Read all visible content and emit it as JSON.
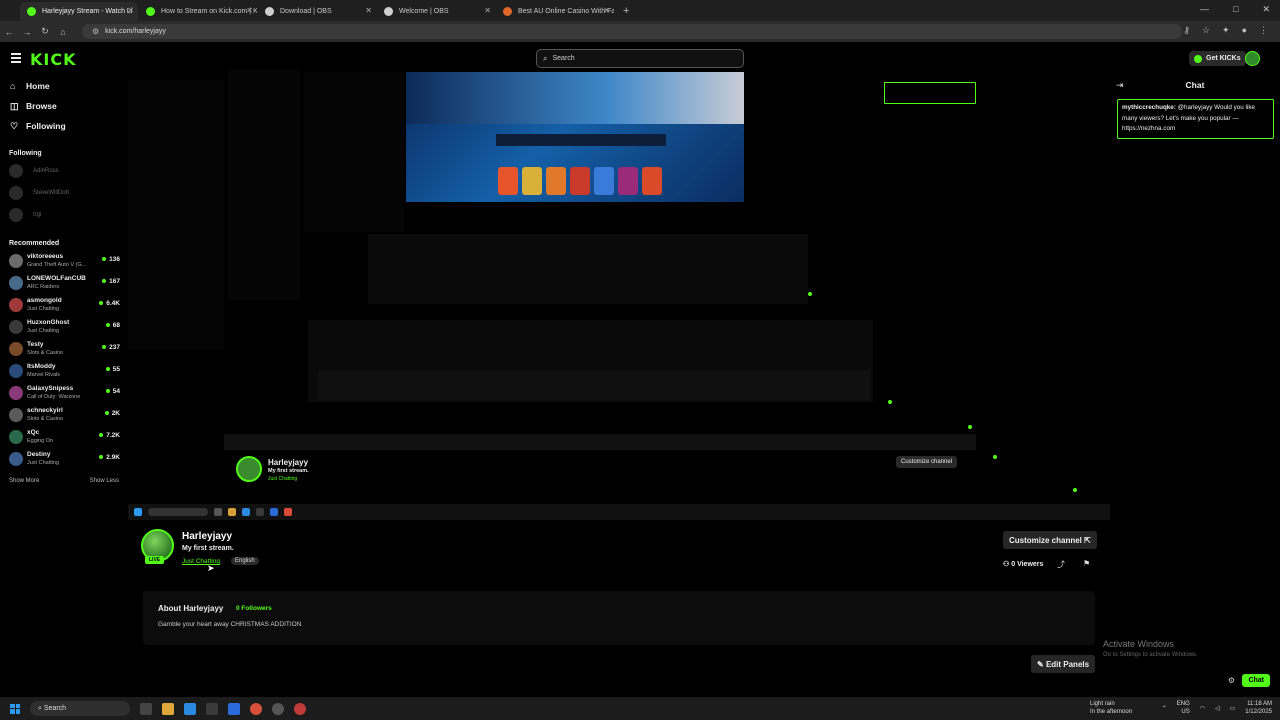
{
  "browser": {
    "tabs": [
      {
        "label": "Harleyjayy Stream - Watch Li",
        "color": "#53fc18",
        "active": true
      },
      {
        "label": "How to Stream on Kick.com | K",
        "color": "#53fc18",
        "active": false
      },
      {
        "label": "Download | OBS",
        "color": "#cfcfcf",
        "active": false
      },
      {
        "label": "Welcome | OBS",
        "color": "#cfcfcf",
        "active": false
      },
      {
        "label": "Best AU Online Casino With Fa",
        "color": "#e0672a",
        "active": false
      }
    ],
    "new_tab": "+",
    "url": "kick.com/harleyjayy"
  },
  "header": {
    "logo": "KICK",
    "search_placeholder": "Search",
    "get_kicks": "Get KICKs"
  },
  "sidebar": {
    "nav": [
      {
        "label": "Home",
        "icon": "⌂"
      },
      {
        "label": "Browse",
        "icon": "◫"
      },
      {
        "label": "Following",
        "icon": "♡"
      }
    ],
    "following_title": "Following",
    "following": [
      "AdinRoss",
      "SteveWillDoIt",
      "trgi"
    ],
    "recommended_title": "Recommended",
    "recommended": [
      {
        "name": "viktoreeeus",
        "category": "Grand Theft Auto V (G...",
        "viewers": "136",
        "color": "#6b6b6b"
      },
      {
        "name": "LONEWOLFanCUB",
        "category": "ARC Raiders",
        "viewers": "167",
        "color": "#4a6a8a"
      },
      {
        "name": "asmongold",
        "category": "Just Chatting",
        "viewers": "6.4K",
        "color": "#a03a3a"
      },
      {
        "name": "HuzxonGhost",
        "category": "Just Chatting",
        "viewers": "68",
        "color": "#3a3a3a"
      },
      {
        "name": "Testy",
        "category": "Slots & Casino",
        "viewers": "237",
        "color": "#7a4a2a"
      },
      {
        "name": "ItsModdy",
        "category": "Marvel Rivals",
        "viewers": "55",
        "color": "#2a4a7a"
      },
      {
        "name": "GalaxySnipess",
        "category": "Call of Duty: Warzone",
        "viewers": "54",
        "color": "#8a3a7a"
      },
      {
        "name": "schneckyirl",
        "category": "Slots & Casino",
        "viewers": "2K",
        "color": "#5a5a5a"
      },
      {
        "name": "xQc",
        "category": "Egging On",
        "viewers": "7.2K",
        "color": "#2a6a4a"
      },
      {
        "name": "Destiny",
        "category": "Just Chatting",
        "viewers": "2.9K",
        "color": "#3a5a8a"
      }
    ],
    "show_more": "Show More",
    "show_less": "Show Less"
  },
  "stream": {
    "streamer": "Harleyjayy",
    "title": "My first stream.",
    "category": "Just Chatting",
    "language": "English",
    "customize": "Customize channel",
    "viewers": "0 Viewers",
    "about_title": "About Harleyjayy",
    "followers": "0 Followers",
    "about_text": "Gamble your heart away CHRISTMAS ADDITION",
    "edit_panels": "Edit Panels"
  },
  "chat": {
    "title": "Chat",
    "message_user": "mythiccrechuqke:",
    "message_text": "@harleyjayy Would you like many viewers? Let's make you popular — https://nezhna.com",
    "chat_button": "Chat",
    "activate_title": "Activate Windows",
    "activate_sub": "Go to Settings to activate Windows."
  },
  "taskbar": {
    "search": "Search",
    "weather_1": "Light rain",
    "weather_2": "In the afternoon",
    "lang_1": "ENG",
    "lang_2": "US",
    "time": "11:18 AM",
    "date": "1/12/2025"
  }
}
